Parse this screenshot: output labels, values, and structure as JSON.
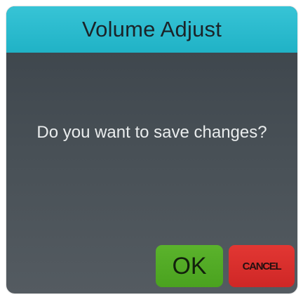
{
  "dialog": {
    "title": "Volume Adjust",
    "message": "Do you want to save changes?",
    "buttons": {
      "ok_label": "OK",
      "cancel_label": "CANCEL"
    }
  },
  "colors": {
    "titlebar": "#28b9cc",
    "body": "#454c52",
    "ok": "#53ab25",
    "cancel": "#d92f2c"
  }
}
